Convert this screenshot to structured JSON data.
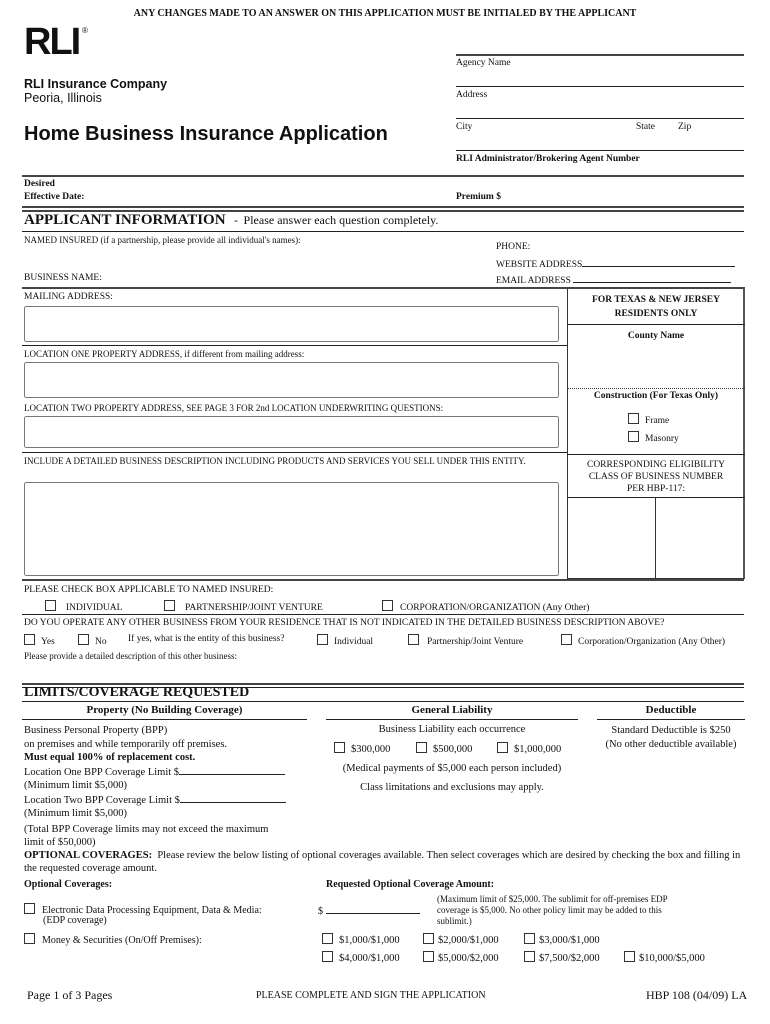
{
  "top_notice": "ANY CHANGES MADE TO AN ANSWER ON THIS APPLICATION MUST BE INITIALED BY THE APPLICANT",
  "logo": {
    "text": "RLI",
    "mark": "®"
  },
  "company": {
    "name": "RLI Insurance Company",
    "location": "Peoria, Illinois"
  },
  "form_title": "Home Business Insurance Application",
  "agency": {
    "agency_name": "Agency Name",
    "address": "Address",
    "city": "City",
    "state": "State",
    "zip": "Zip",
    "agent_number": "RLI Administrator/Brokering Agent Number"
  },
  "effective_date": {
    "line1": "Desired",
    "line2": "Effective Date:"
  },
  "premium": "Premium  $",
  "applicant": {
    "heading": "APPLICANT INFORMATION",
    "dash": "-",
    "subheading": "Please answer each question completely.",
    "named_insured": "NAMED INSURED (if a partnership, please provide all individual's names):",
    "phone": "PHONE:",
    "website": "WEBSITE ADDRESS",
    "email": "EMAIL ADDRESS",
    "business_name": "BUSINESS NAME:",
    "mailing_address": "MAILING ADDRESS:",
    "location_one": "LOCATION ONE PROPERTY ADDRESS, if different from mailing address:",
    "location_two": "LOCATION TWO PROPERTY ADDRESS, SEE PAGE 3 FOR 2nd LOCATION UNDERWRITING QUESTIONS:",
    "business_description": "INCLUDE A DETAILED BUSINESS DESCRIPTION INCLUDING PRODUCTS AND SERVICES YOU SELL UNDER THIS ENTITY."
  },
  "texas_box": {
    "header_line1": "FOR TEXAS & NEW JERSEY",
    "header_line2": "RESIDENTS ONLY",
    "county": "County Name",
    "construction": "Construction (For Texas Only)",
    "options": [
      "Frame",
      "Masonry"
    ],
    "eligibility_line1": "CORRESPONDING ELIGIBILITY",
    "eligibility_line2": "CLASS OF BUSINESS NUMBER",
    "eligibility_line3": "PER HBP-117:"
  },
  "entity": {
    "prompt": "PLEASE CHECK BOX APPLICABLE TO NAMED INSURED:",
    "options": [
      "INDIVIDUAL",
      "PARTNERSHIP/JOINT VENTURE",
      "CORPORATION/ORGANIZATION"
    ],
    "suffix": "(Any Other)"
  },
  "other_business": {
    "question": "DO YOU OPERATE ANY OTHER BUSINESS FROM YOUR RESIDENCE THAT IS NOT INDICATED IN THE DETAILED BUSINESS DESCRIPTION ABOVE?",
    "yes": "Yes",
    "no": "No",
    "entity_prompt": "If yes, what is the entity of this business?",
    "entity_options": [
      "Individual",
      "Partnership/Joint Venture",
      "Corporation/Organization (Any Other)"
    ],
    "describe": "Please provide a detailed description of this other business:"
  },
  "limits": {
    "heading": "LIMITS/COVERAGE REQUESTED",
    "property": {
      "heading": "Property (No Building Coverage)",
      "line1": "Business Personal Property (BPP)",
      "line2": "on premises and while temporarily off premises.",
      "line3": "Must equal 100% of replacement cost.",
      "loc1": "Location One BPP Coverage Limit $",
      "loc1_min": "(Minimum limit $5,000)",
      "loc2": "Location Two BPP Coverage Limit $",
      "loc2_min": "(Minimum limit $5,000)",
      "total1": "(Total BPP Coverage limits may not exceed the maximum",
      "total2": "limit of $50,000)"
    },
    "liability": {
      "heading": "General Liability",
      "line1": "Business Liability each occurrence",
      "options": [
        "$300,000",
        "$500,000",
        "$1,000,000"
      ],
      "medical": "(Medical payments of $5,000 each person included)",
      "class": "Class limitations and exclusions may apply."
    },
    "deductible": {
      "heading": "Deductible",
      "line1": "Standard Deductible is $250",
      "line2": "(No other deductible available)"
    }
  },
  "optional": {
    "intro_bold": "OPTIONAL COVERAGES:",
    "intro_text": "Please review the below listing of optional coverages available. Then select coverages which are desired by checking the box and filling in the requested coverage amount.",
    "col1": "Optional Coverages:",
    "col2": "Requested Optional Coverage Amount:",
    "edp_label1": "Electronic Data Processing Equipment, Data & Media:",
    "edp_label2": "(EDP coverage)",
    "edp_dollar": "$",
    "edp_note1": "(Maximum limit of $25,000. The sublimit for off-premises EDP",
    "edp_note2": "coverage is $5,000. No other policy limit may be added to this",
    "edp_note3": "sublimit.)",
    "money_label": "Money & Securities (On/Off Premises):",
    "money_row1": [
      "$1,000/$1,000",
      "$2,000/$1,000",
      "$3,000/$1,000"
    ],
    "money_row2": [
      "$4,000/$1,000",
      "$5,000/$2,000",
      "$7,500/$2,000",
      "$10,000/$5,000"
    ]
  },
  "footer": {
    "page": "Page 1 of 3 Pages",
    "center": "PLEASE COMPLETE AND SIGN THE APPLICATION",
    "form_id": "HBP 108 (04/09) LA"
  }
}
